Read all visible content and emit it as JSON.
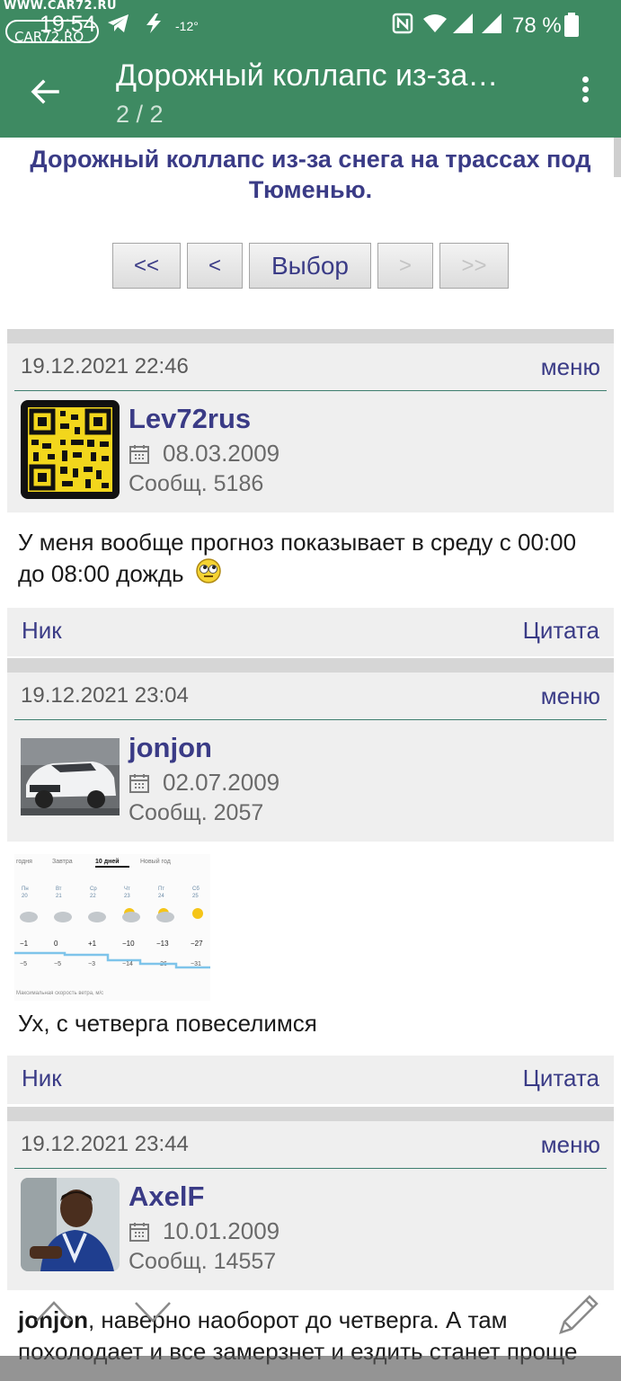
{
  "watermark": {
    "site": "WWW.CAR72.RU",
    "logo": "CAR72.RO"
  },
  "status_bar": {
    "time": "19:54",
    "temperature": "-12°",
    "battery": "78 %"
  },
  "app_bar": {
    "title": "Дорожный коллапс из-за…",
    "page": "2 / 2"
  },
  "topic": {
    "title": "Дорожный коллапс из-за снега на трассах под Тюменью."
  },
  "pager": {
    "first": "<<",
    "prev": "<",
    "select": "Выбор",
    "next": ">",
    "last": ">>"
  },
  "posts": [
    {
      "date": "19.12.2021 22:46",
      "menu": "меню",
      "nick": "Lev72rus",
      "reg_date": "08.03.2009",
      "messages": "Сообщ. 5186",
      "text": "У меня вообще прогноз показывает в среду с 00:00 до 08:00 дождь",
      "foot_nick": "Ник",
      "foot_quote": "Цитата"
    },
    {
      "date": "19.12.2021 23:04",
      "menu": "меню",
      "nick": "jonjon",
      "reg_date": "02.07.2009",
      "messages": "Сообщ. 2057",
      "text": "Ух, с четверга повеселимся",
      "foot_nick": "Ник",
      "foot_quote": "Цитата"
    },
    {
      "date": "19.12.2021 23:44",
      "menu": "меню",
      "nick": "AxelF",
      "reg_date": "10.01.2009",
      "messages": "Сообщ. 14557",
      "quote_nick": "jonjon",
      "text": ", наверно наоборот до четверга. А там похолодает и все замерзнет и ездить станет проще"
    }
  ],
  "weather_thumb": {
    "tabs": [
      "годня",
      "Завтра",
      "10 дней",
      "Новый год"
    ],
    "days": [
      "Пн",
      "Вт",
      "Ср",
      "Чт",
      "Пт",
      "Сб"
    ],
    "dates": [
      "20",
      "21",
      "22",
      "23",
      "24",
      "25"
    ],
    "highs": [
      "−1",
      "0",
      "+1",
      "−10",
      "−13",
      "−27"
    ],
    "lows": [
      "−5",
      "−5",
      "−3",
      "−14",
      "−26",
      "−31"
    ],
    "caption": "Максимальная скорость ветра, м/с"
  },
  "colors": {
    "app_bar": "#3e8a62",
    "link": "#3a3b86",
    "divider": "#3e7e6f"
  }
}
